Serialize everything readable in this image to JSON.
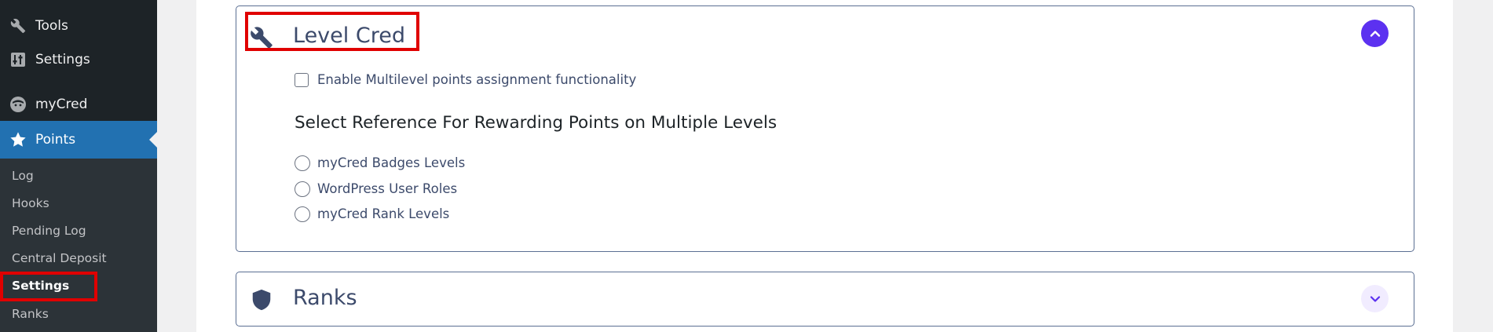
{
  "sidebar": {
    "items": [
      {
        "label": "Tools",
        "icon": "wrench-icon"
      },
      {
        "label": "Settings",
        "icon": "sliders-icon"
      },
      {
        "label": "myCred",
        "icon": "mycred-logo-icon"
      },
      {
        "label": "Points",
        "icon": "star-icon"
      }
    ],
    "submenu": [
      {
        "label": "Log"
      },
      {
        "label": "Hooks"
      },
      {
        "label": "Pending Log"
      },
      {
        "label": "Central Deposit"
      },
      {
        "label": "Settings"
      },
      {
        "label": "Ranks"
      }
    ]
  },
  "level_cred": {
    "title": "Level Cred",
    "icon": "wrench-icon",
    "enable_label": "Enable Multilevel points assignment functionality",
    "enable_checked": false,
    "reference_heading": "Select Reference For Rewarding Points on Multiple Levels",
    "options": [
      {
        "label": "myCred Badges Levels"
      },
      {
        "label": "WordPress User Roles"
      },
      {
        "label": "myCred Rank Levels"
      }
    ]
  },
  "ranks": {
    "title": "Ranks",
    "icon": "shield-icon"
  },
  "colors": {
    "accent": "#5c31f0",
    "highlight": "#e00000",
    "wp_blue": "#2271b1"
  }
}
